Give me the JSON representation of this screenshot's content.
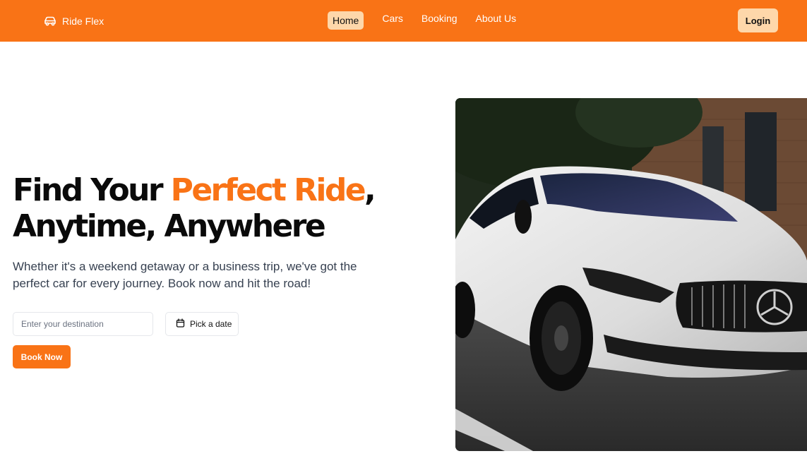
{
  "brand": {
    "name": "Ride Flex",
    "icon": "car-icon"
  },
  "nav": {
    "links": [
      {
        "label": "Home",
        "active": true
      },
      {
        "label": "Cars",
        "active": false
      },
      {
        "label": "Booking",
        "active": false
      },
      {
        "label": "About Us",
        "active": false
      }
    ],
    "login_label": "Login"
  },
  "hero": {
    "headline_part1": "Find Your ",
    "headline_accent": "Perfect Ride",
    "headline_part2": ",",
    "headline_line2": "Anytime, Anywhere",
    "subtext": "Whether it's a weekend getaway or a business trip, we've got the perfect car for every journey. Book now and hit the road!",
    "destination_placeholder": "Enter your destination",
    "destination_value": "",
    "date_label": "Pick a date",
    "date_icon": "calendar-icon",
    "book_label": "Book Now"
  },
  "colors": {
    "accent": "#f97316",
    "accent_light": "#fed7aa",
    "text_dark": "#0a0a0a",
    "text_muted": "#374151"
  }
}
